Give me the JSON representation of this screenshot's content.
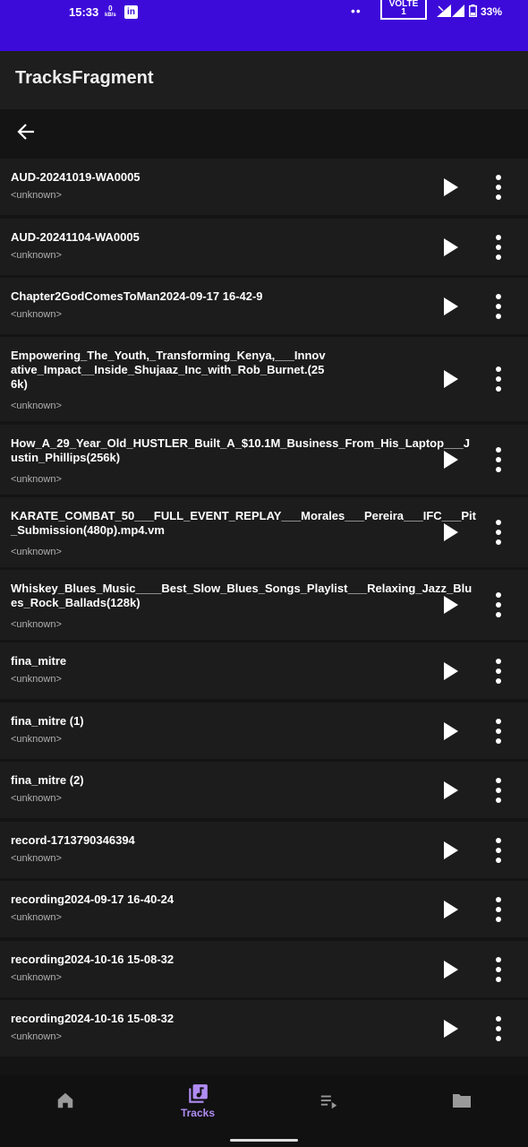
{
  "status_bar": {
    "time": "15:33",
    "data_rate": "0",
    "data_unit": "kB/s",
    "volte_label": "VOLTE",
    "sim_number": "1",
    "battery": "33%"
  },
  "app_bar": {
    "title": "TracksFragment"
  },
  "tracks": [
    {
      "title": "AUD-20241019-WA0005",
      "artist": "<unknown>"
    },
    {
      "title": "AUD-20241104-WA0005",
      "artist": "<unknown>"
    },
    {
      "title": "Chapter2GodComesToMan2024-09-17 16-42-9",
      "artist": "<unknown>"
    },
    {
      "title": "Empowering_The_Youth,_Transforming_Kenya,___Innovative_Impact__Inside_Shujaaz_Inc_with_Rob_Burnet.(256k)",
      "artist": "<unknown>"
    },
    {
      "title": "How_A_29_Year_Old_HUSTLER_Built_A_$10.1M_Business_From_His_Laptop___Justin_Phillips(256k)",
      "artist": "<unknown>"
    },
    {
      "title": "KARATE_COMBAT_50___FULL_EVENT_REPLAY___Morales___Pereira___IFC___Pit_Submission(480p).mp4.vm",
      "artist": "<unknown>"
    },
    {
      "title": "Whiskey_Blues_Music____Best_Slow_Blues_Songs_Playlist___Relaxing_Jazz_Blues_Rock_Ballads(128k)",
      "artist": "<unknown>"
    },
    {
      "title": "fina_mitre",
      "artist": "<unknown>"
    },
    {
      "title": "fina_mitre (1)",
      "artist": "<unknown>"
    },
    {
      "title": "fina_mitre (2)",
      "artist": "<unknown>"
    },
    {
      "title": "record-1713790346394",
      "artist": "<unknown>"
    },
    {
      "title": "recording2024-09-17 16-40-24",
      "artist": "<unknown>"
    },
    {
      "title": "recording2024-10-16 15-08-32",
      "artist": "<unknown>"
    },
    {
      "title": "recording2024-10-16 15-08-32",
      "artist": "<unknown>"
    }
  ],
  "bottom_nav": {
    "active": "tracks",
    "items": [
      {
        "id": "home",
        "icon": "home-icon",
        "label": ""
      },
      {
        "id": "tracks",
        "icon": "music-library-icon",
        "label": "Tracks"
      },
      {
        "id": "queue",
        "icon": "queue-music-icon",
        "label": ""
      },
      {
        "id": "folders",
        "icon": "folder-icon",
        "label": ""
      }
    ]
  },
  "colors": {
    "status_bar": "#3d0bd9",
    "accent": "#b08cf2",
    "row_background": "#1c1c1c"
  }
}
